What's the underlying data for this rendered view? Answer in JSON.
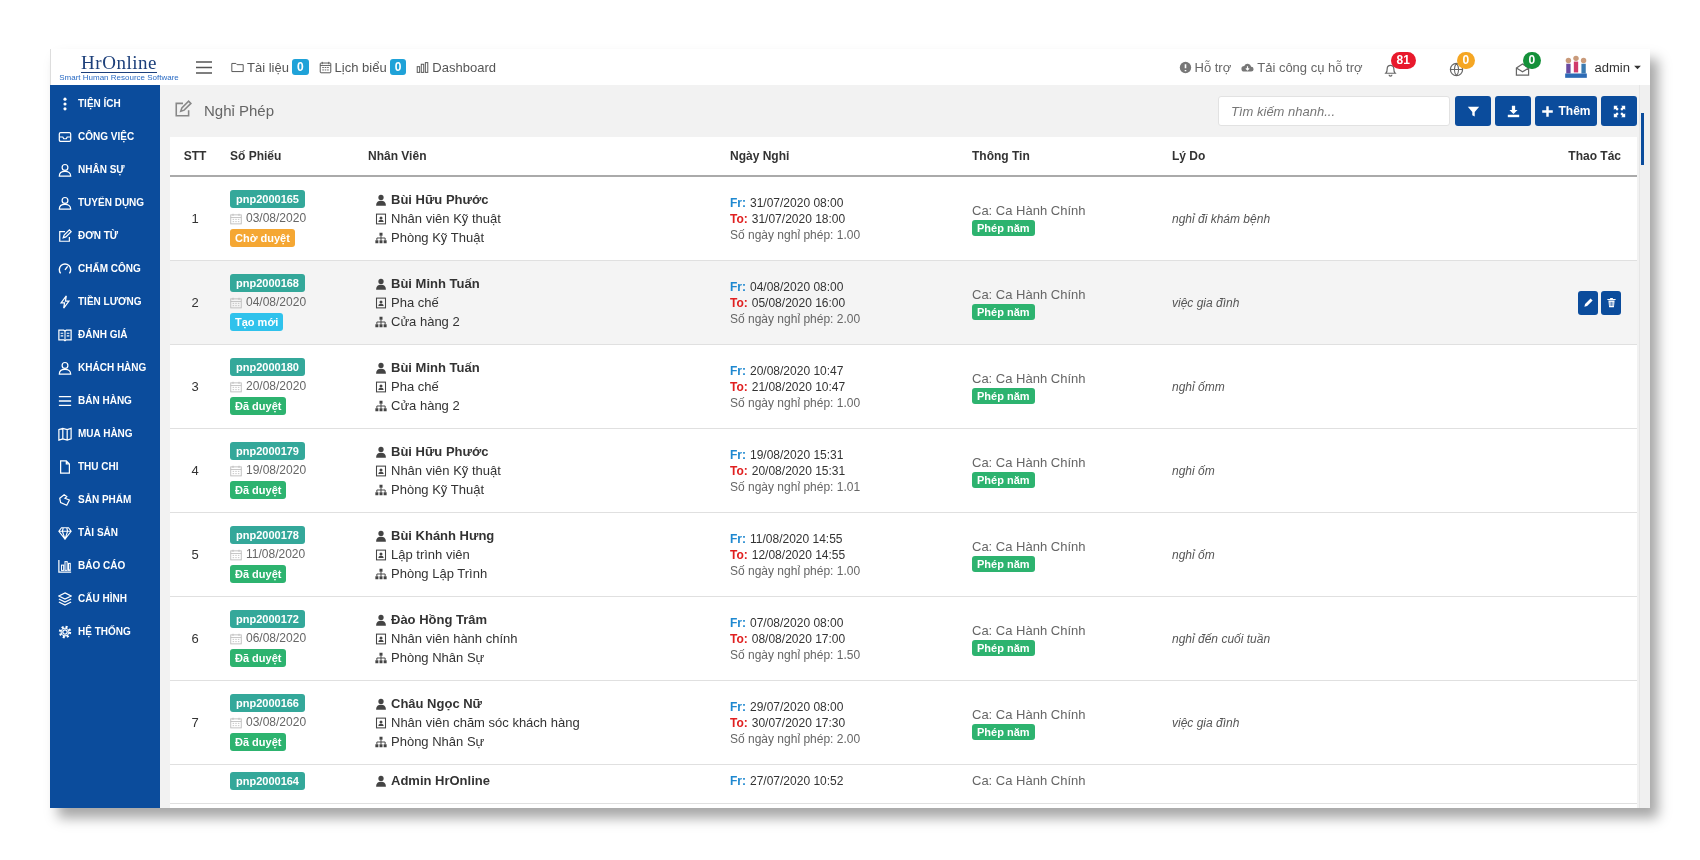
{
  "logo": {
    "name": "HrOnline",
    "tagline": "Smart Human Resource Software"
  },
  "nav_links": [
    {
      "label": "Tài liệu",
      "count": "0"
    },
    {
      "label": "Lịch biểu",
      "count": "0"
    },
    {
      "label": "Dashboard"
    }
  ],
  "support_links": [
    "Hỗ trợ",
    "Tải công cụ hỗ trợ"
  ],
  "notifications": [
    {
      "count": "81",
      "color": "#e8192c"
    },
    {
      "count": "0",
      "color": "#f5a623"
    },
    {
      "count": "0",
      "color": "#14913a"
    }
  ],
  "user": {
    "name": "admin"
  },
  "sidebar": {
    "items": [
      {
        "label": "TIỆN ÍCH"
      },
      {
        "label": "CÔNG VIỆC"
      },
      {
        "label": "NHÂN SỰ"
      },
      {
        "label": "TUYỂN DỤNG"
      },
      {
        "label": "ĐƠN TỪ"
      },
      {
        "label": "CHẤM CÔNG"
      },
      {
        "label": "TIỀN LƯƠNG"
      },
      {
        "label": "ĐÁNH GIÁ"
      },
      {
        "label": "KHÁCH HÀNG"
      },
      {
        "label": "BÁN HÀNG"
      },
      {
        "label": "MUA HÀNG"
      },
      {
        "label": "THU CHI"
      },
      {
        "label": "SẢN PHẨM"
      },
      {
        "label": "TÀI SẢN"
      },
      {
        "label": "BÁO CÁO"
      },
      {
        "label": "CẤU HÌNH"
      },
      {
        "label": "HỆ THỐNG"
      }
    ]
  },
  "page": {
    "title": "Nghỉ Phép"
  },
  "search": {
    "placeholder": "Tìm kiếm nhanh..."
  },
  "toolbar_buttons": [
    {
      "kind": "filter"
    },
    {
      "kind": "download"
    },
    {
      "kind": "add",
      "label": "Thêm"
    },
    {
      "kind": "expand"
    }
  ],
  "table": {
    "columns": [
      "STT",
      "Số Phiếu",
      "Nhân Viên",
      "Ngày Nghỉ",
      "Thông Tin",
      "Lý Do",
      "Thao Tác"
    ],
    "rows": [
      {
        "index": "1",
        "code": "pnp2000165",
        "date": "03/08/2020",
        "status": {
          "label": "Chờ duyệt",
          "kind": "pending"
        },
        "employee": "Bùi Hữu Phước",
        "position": "Nhân viên Kỹ thuật",
        "department": "Phòng Kỹ Thuật",
        "from_label": "Fr:",
        "from": "31/07/2020 08:00",
        "to_label": "To:",
        "to": "31/07/2020 18:00",
        "days": "Số ngày nghỉ phép: 1.00",
        "shift": "Ca: Ca Hành Chính",
        "leave_type": "Phép năm",
        "reason": "nghỉ đi khám bệnh",
        "hovered": false
      },
      {
        "index": "2",
        "code": "pnp2000168",
        "date": "04/08/2020",
        "status": {
          "label": "Tạo mới",
          "kind": "new"
        },
        "employee": "Bùi Minh Tuấn",
        "position": "Pha chế",
        "department": "Cửa hàng 2",
        "from_label": "Fr:",
        "from": "04/08/2020 08:00",
        "to_label": "To:",
        "to": "05/08/2020 16:00",
        "days": "Số ngày nghỉ phép: 2.00",
        "shift": "Ca: Ca Hành Chính",
        "leave_type": "Phép năm",
        "reason": "việc gia đình",
        "hovered": true
      },
      {
        "index": "3",
        "code": "pnp2000180",
        "date": "20/08/2020",
        "status": {
          "label": "Đã duyệt",
          "kind": "approved"
        },
        "employee": "Bùi Minh Tuấn",
        "position": "Pha chế",
        "department": "Cửa hàng 2",
        "from_label": "Fr:",
        "from": "20/08/2020 10:47",
        "to_label": "To:",
        "to": "21/08/2020 10:47",
        "days": "Số ngày nghỉ phép: 1.00",
        "shift": "Ca: Ca Hành Chính",
        "leave_type": "Phép năm",
        "reason": "nghỉ ốmm",
        "hovered": false
      },
      {
        "index": "4",
        "code": "pnp2000179",
        "date": "19/08/2020",
        "status": {
          "label": "Đã duyệt",
          "kind": "approved"
        },
        "employee": "Bùi Hữu Phước",
        "position": "Nhân viên Kỹ thuật",
        "department": "Phòng Kỹ Thuật",
        "from_label": "Fr:",
        "from": "19/08/2020 15:31",
        "to_label": "To:",
        "to": "20/08/2020 15:31",
        "days": "Số ngày nghỉ phép: 1.01",
        "shift": "Ca: Ca Hành Chính",
        "leave_type": "Phép năm",
        "reason": "nghi ốm",
        "hovered": false
      },
      {
        "index": "5",
        "code": "pnp2000178",
        "date": "11/08/2020",
        "status": {
          "label": "Đã duyệt",
          "kind": "approved"
        },
        "employee": "Bùi Khánh Hưng",
        "position": "Lập trình viên",
        "department": "Phòng Lập Trình",
        "from_label": "Fr:",
        "from": "11/08/2020 14:55",
        "to_label": "To:",
        "to": "12/08/2020 14:55",
        "days": "Số ngày nghỉ phép: 1.00",
        "shift": "Ca: Ca Hành Chính",
        "leave_type": "Phép năm",
        "reason": "nghỉ ốm",
        "hovered": false
      },
      {
        "index": "6",
        "code": "pnp2000172",
        "date": "06/08/2020",
        "status": {
          "label": "Đã duyệt",
          "kind": "approved"
        },
        "employee": "Đào Hồng Trâm",
        "position": "Nhân viên hành chính",
        "department": "Phòng Nhân Sự",
        "from_label": "Fr:",
        "from": "07/08/2020 08:00",
        "to_label": "To:",
        "to": "08/08/2020 17:00",
        "days": "Số ngày nghỉ phép: 1.50",
        "shift": "Ca: Ca Hành Chính",
        "leave_type": "Phép năm",
        "reason": "nghỉ đến cuối tuần",
        "hovered": false
      },
      {
        "index": "7",
        "code": "pnp2000166",
        "date": "03/08/2020",
        "status": {
          "label": "Đã duyệt",
          "kind": "approved"
        },
        "employee": "Châu Ngọc Nữ",
        "position": "Nhân viên chăm sóc khách hàng",
        "department": "Phòng Nhân Sự",
        "from_label": "Fr:",
        "from": "29/07/2020 08:00",
        "to_label": "To:",
        "to": "30/07/2020 17:30",
        "days": "Số ngày nghỉ phép: 2.00",
        "shift": "Ca: Ca Hành Chính",
        "leave_type": "Phép năm",
        "reason": "việc gia đình",
        "hovered": false
      },
      {
        "code": "pnp2000164",
        "employee": "Admin HrOnline",
        "from_label": "Fr:",
        "from": "27/07/2020 10:52",
        "shift": "Ca: Ca Hành Chính",
        "hovered": false
      }
    ]
  }
}
